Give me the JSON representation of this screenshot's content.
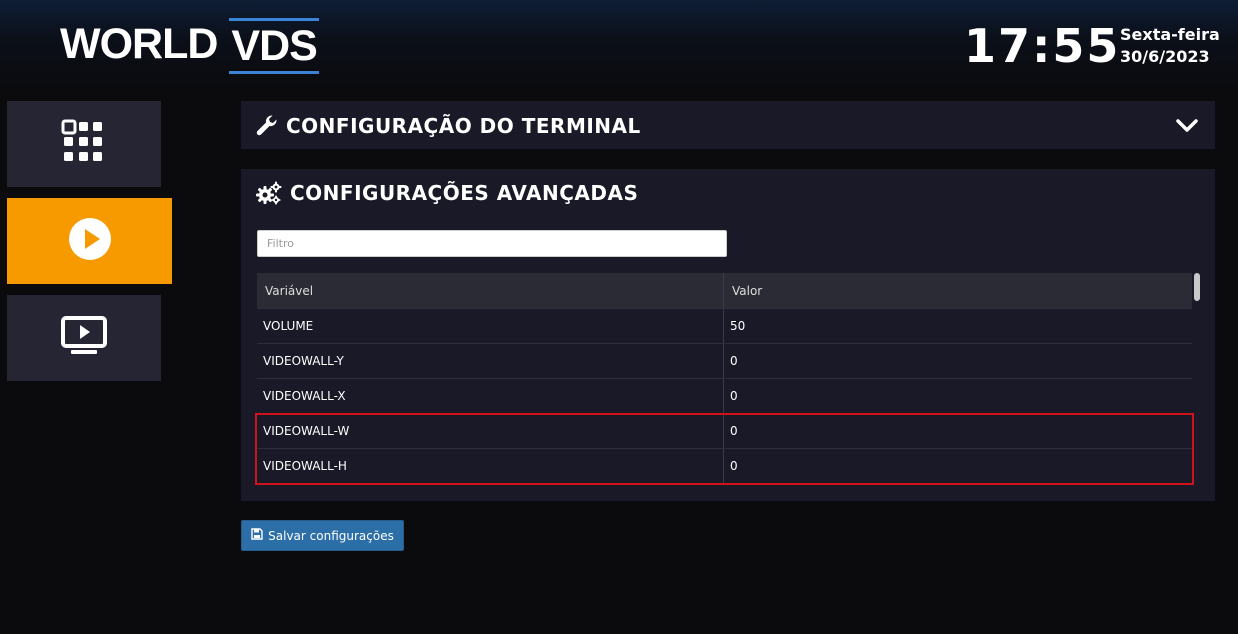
{
  "header": {
    "logo_text_1": "WORLD",
    "logo_text_2": "VDS",
    "time": "17:55",
    "weekday": "Sexta-feira",
    "date": "30/6/2023"
  },
  "sidebar": {
    "items": [
      {
        "icon": "grid-apps-icon",
        "active": false
      },
      {
        "icon": "play-circle-icon",
        "active": true
      },
      {
        "icon": "monitor-play-icon",
        "active": false
      }
    ]
  },
  "terminal_section": {
    "title": "CONFIGURAÇÃO DO TERMINAL",
    "icon": "wrench-icon",
    "toggle_icon": "chevron-down-icon"
  },
  "advanced_section": {
    "title": "CONFIGURAÇÕES AVANÇADAS",
    "icon": "gears-icon",
    "filter_placeholder": "Filtro",
    "columns": [
      "Variável",
      "Valor"
    ],
    "rows": [
      {
        "variable": "VOLUME",
        "value": "50"
      },
      {
        "variable": "VIDEOWALL-Y",
        "value": "0"
      },
      {
        "variable": "VIDEOWALL-X",
        "value": "0"
      },
      {
        "variable": "VIDEOWALL-W",
        "value": "0"
      },
      {
        "variable": "VIDEOWALL-H",
        "value": "0"
      }
    ]
  },
  "save_button": {
    "label": "Salvar configurações",
    "icon": "floppy-disk-icon"
  },
  "colors": {
    "accent": "#f79a00",
    "button": "#2c6ea8",
    "highlight": "#d0121b",
    "logo_underline": "#3b83d6"
  }
}
